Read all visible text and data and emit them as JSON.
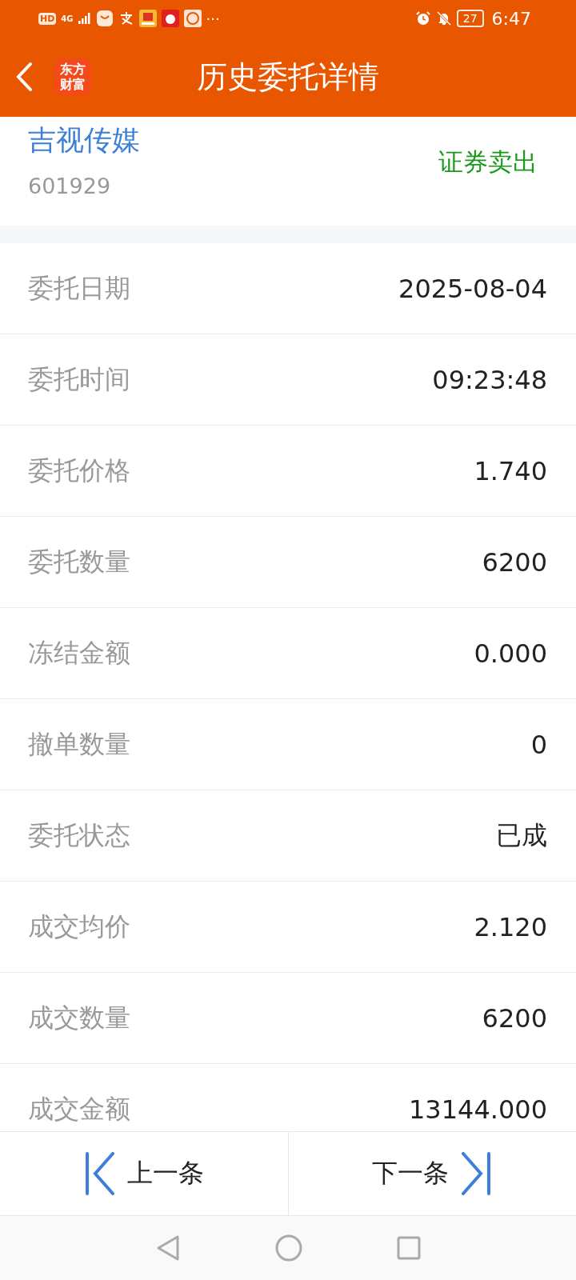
{
  "status_bar": {
    "hd": "HD",
    "network": "4G",
    "more": "···",
    "battery": "27",
    "time": "6:47"
  },
  "header": {
    "logo_lines": [
      "东方",
      "财富"
    ],
    "title": "历史委托详情"
  },
  "stock": {
    "name": "吉视传媒",
    "code": "601929",
    "action": "证券卖出"
  },
  "rows": [
    {
      "label": "委托日期",
      "value": "2025-08-04"
    },
    {
      "label": "委托时间",
      "value": "09:23:48"
    },
    {
      "label": "委托价格",
      "value": "1.740"
    },
    {
      "label": "委托数量",
      "value": "6200"
    },
    {
      "label": "冻结金额",
      "value": "0.000"
    },
    {
      "label": "撤单数量",
      "value": "0"
    },
    {
      "label": "委托状态",
      "value": "已成"
    },
    {
      "label": "成交均价",
      "value": "2.120"
    },
    {
      "label": "成交数量",
      "value": "6200"
    },
    {
      "label": "成交金额",
      "value": "13144.000"
    }
  ],
  "footer": {
    "prev": "上一条",
    "next": "下一条"
  }
}
